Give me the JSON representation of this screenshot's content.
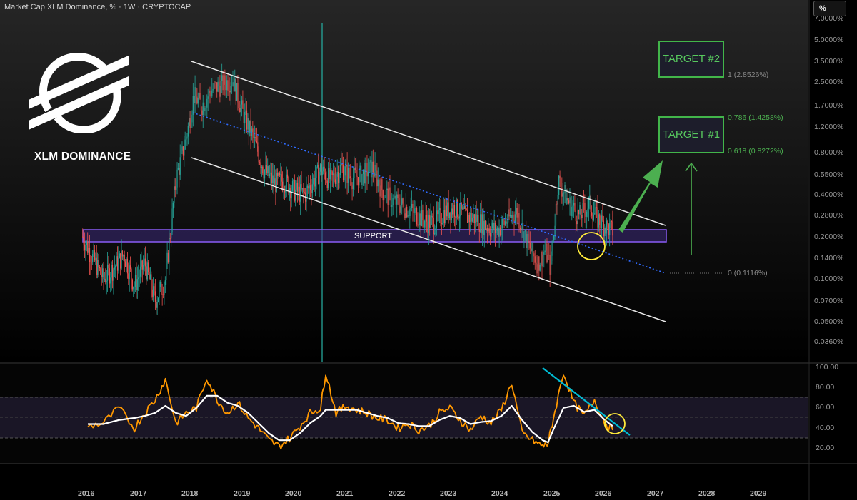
{
  "header": {
    "title": "Market Cap XLM Dominance, % · 1W · CRYPTOCAP",
    "scale_button": "%"
  },
  "brand": {
    "label": "XLM DOMINANCE",
    "logo_icon": "stellar-logo-icon"
  },
  "targets": [
    {
      "label": "TARGET #2"
    },
    {
      "label": "TARGET #1"
    }
  ],
  "fib_levels": [
    {
      "label": "1 (2.8526%)",
      "color": "#8a8a8a"
    },
    {
      "label": "0.786 (1.4258%)",
      "color": "#4caf50"
    },
    {
      "label": "0.618 (0.8272%)",
      "color": "#4caf50"
    },
    {
      "label": "0 (0.1116%)",
      "color": "#8a8a8a"
    }
  ],
  "support_label": "SUPPORT",
  "colors": {
    "background": "#000000",
    "candle_up": "#26a69a",
    "candle_down": "#ef5350",
    "channel": "#ffffff",
    "midline": "#2962ff",
    "support_fill": "#3d2a7a",
    "support_border": "#8a5cf6",
    "target": "#4caf50",
    "rsi": "#ff9800",
    "rsi_ma": "#ffffff",
    "rsi_trend": "#00bcd4",
    "highlight": "#ffeb3b"
  },
  "chart_data": [
    {
      "type": "candlestick",
      "title": "Market Cap XLM Dominance, % · 1W · CRYPTOCAP",
      "y_scale": "log",
      "y_unit": "%",
      "y_ticks": [
        "7.0000%",
        "5.0000%",
        "3.5000%",
        "2.5000%",
        "1.7000%",
        "1.2000%",
        "0.8000%",
        "0.5500%",
        "0.4000%",
        "0.2800%",
        "0.2000%",
        "0.1400%",
        "0.1000%",
        "0.0700%",
        "0.0500%",
        "0.0360%"
      ],
      "x_ticks": [
        "2016",
        "2017",
        "2018",
        "2019",
        "2020",
        "2021",
        "2022",
        "2023",
        "2024",
        "2025",
        "2026",
        "2027",
        "2028",
        "2029"
      ],
      "series": [
        {
          "name": "XLM Dominance",
          "x": [
            2015.9,
            2016.1,
            2016.3,
            2016.5,
            2016.7,
            2016.9,
            2017.1,
            2017.3,
            2017.5,
            2017.7,
            2017.9,
            2018.05,
            2018.2,
            2018.4,
            2018.6,
            2018.8,
            2019.0,
            2019.2,
            2019.4,
            2019.6,
            2019.8,
            2020.0,
            2020.2,
            2020.5,
            2020.7,
            2020.9,
            2021.1,
            2021.3,
            2021.5,
            2021.7,
            2021.9,
            2022.1,
            2022.3,
            2022.5,
            2022.7,
            2022.9,
            2023.1,
            2023.3,
            2023.5,
            2023.7,
            2023.9,
            2024.1,
            2024.3,
            2024.5,
            2024.7,
            2024.85,
            2024.95,
            2025.1,
            2025.3,
            2025.5,
            2025.7,
            2025.85,
            2026.0,
            2026.15
          ],
          "values": [
            0.2,
            0.14,
            0.1,
            0.12,
            0.15,
            0.09,
            0.13,
            0.07,
            0.1,
            0.5,
            1.0,
            2.0,
            1.7,
            2.2,
            2.4,
            2.6,
            1.5,
            1.0,
            0.6,
            0.48,
            0.5,
            0.42,
            0.4,
            0.6,
            0.5,
            0.62,
            0.52,
            0.55,
            0.62,
            0.42,
            0.36,
            0.33,
            0.3,
            0.26,
            0.25,
            0.3,
            0.32,
            0.28,
            0.27,
            0.24,
            0.22,
            0.26,
            0.3,
            0.18,
            0.13,
            0.16,
            0.12,
            0.5,
            0.35,
            0.28,
            0.34,
            0.27,
            0.24,
            0.22
          ]
        }
      ],
      "annotations": {
        "channel": "descending parallel channel",
        "support": "SUPPORT",
        "targets": [
          "TARGET #2",
          "TARGET #1"
        ],
        "fibonacci": [
          "1 (2.8526%)",
          "0.786 (1.4258%)",
          "0.618 (0.8272%)",
          "0 (0.1116%)"
        ]
      }
    },
    {
      "type": "line",
      "y_ticks": [
        "100.00",
        "80.00",
        "60.00",
        "40.00",
        "20.00"
      ],
      "ylim": [
        10,
        100
      ],
      "x": [
        2016,
        2016.3,
        2016.6,
        2016.9,
        2017.1,
        2017.3,
        2017.5,
        2017.7,
        2017.9,
        2018.1,
        2018.3,
        2018.5,
        2018.7,
        2018.9,
        2019.1,
        2019.3,
        2019.5,
        2019.7,
        2019.9,
        2020.1,
        2020.3,
        2020.5,
        2020.6,
        2020.8,
        2021.0,
        2021.2,
        2021.4,
        2021.6,
        2021.8,
        2022.0,
        2022.2,
        2022.4,
        2022.6,
        2022.8,
        2023.0,
        2023.2,
        2023.4,
        2023.6,
        2023.8,
        2024.0,
        2024.2,
        2024.4,
        2024.6,
        2024.8,
        2024.9,
        2025.0,
        2025.2,
        2025.4,
        2025.6,
        2025.8,
        2026.0,
        2026.15
      ],
      "series": [
        {
          "values": [
            42,
            45,
            60,
            40,
            55,
            68,
            88,
            45,
            55,
            60,
            90,
            68,
            55,
            65,
            50,
            40,
            28,
            22,
            30,
            42,
            55,
            60,
            95,
            55,
            62,
            58,
            55,
            50,
            48,
            40,
            45,
            38,
            42,
            55,
            60,
            48,
            38,
            52,
            45,
            58,
            85,
            35,
            28,
            22,
            25,
            48,
            95,
            65,
            52,
            68,
            45,
            38
          ]
        },
        {
          "values": [
            44,
            44,
            48,
            50,
            52,
            55,
            62,
            55,
            52,
            60,
            72,
            72,
            65,
            62,
            55,
            45,
            35,
            28,
            28,
            35,
            45,
            52,
            58,
            58,
            58,
            58,
            55,
            52,
            50,
            45,
            44,
            42,
            42,
            48,
            52,
            50,
            44,
            46,
            47,
            52,
            62,
            48,
            36,
            28,
            26,
            38,
            60,
            62,
            56,
            58,
            48,
            42
          ]
        }
      ]
    }
  ]
}
